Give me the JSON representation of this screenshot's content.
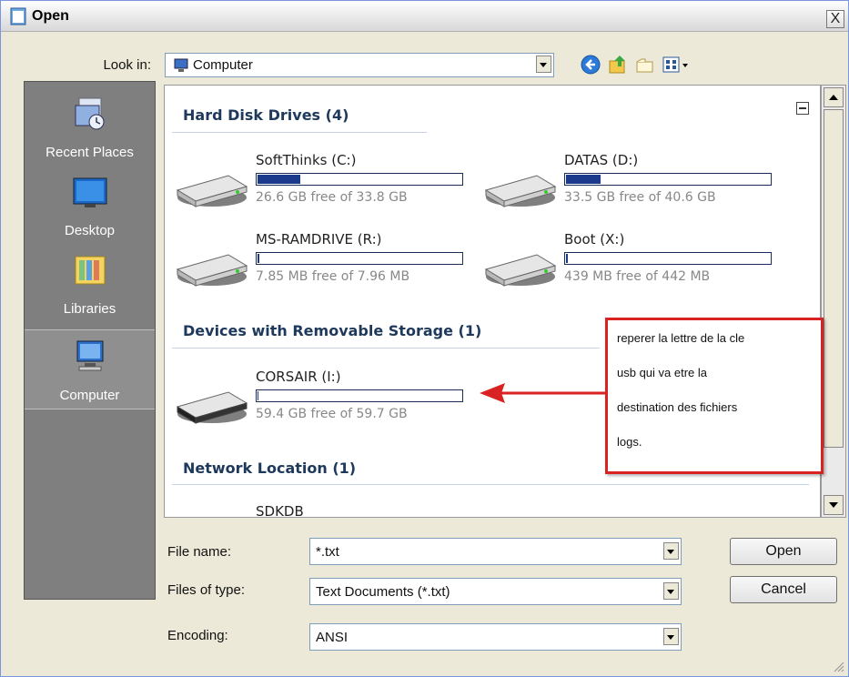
{
  "window": {
    "title": "Open",
    "close_symbol": "X"
  },
  "look_in": {
    "label": "Look in:",
    "value": "Computer"
  },
  "places": [
    {
      "label": "Recent Places",
      "icon": "recent-places-icon"
    },
    {
      "label": "Desktop",
      "icon": "desktop-icon"
    },
    {
      "label": "Libraries",
      "icon": "libraries-icon"
    },
    {
      "label": "Computer",
      "icon": "computer-icon",
      "selected": true
    }
  ],
  "groups": {
    "hard_disks": {
      "header": "Hard Disk Drives (4)",
      "drives": [
        {
          "name": "SoftThinks (C:)",
          "free": "26.6 GB free of 33.8 GB",
          "used_fraction": 0.21
        },
        {
          "name": "DATAS (D:)",
          "free": "33.5 GB free of 40.6 GB",
          "used_fraction": 0.17
        },
        {
          "name": "MS-RAMDRIVE (R:)",
          "free": "7.85 MB free of 7.96 MB",
          "used_fraction": 0.01
        },
        {
          "name": "Boot (X:)",
          "free": "439 MB free of 442 MB",
          "used_fraction": 0.01
        }
      ]
    },
    "removable": {
      "header": "Devices with Removable Storage (1)",
      "drives": [
        {
          "name": "CORSAIR (I:)",
          "free": "59.4 GB free of 59.7 GB",
          "used_fraction": 0.005
        }
      ]
    },
    "network": {
      "header": "Network Location (1)",
      "items": [
        {
          "name": "SDKDB"
        }
      ]
    }
  },
  "annotation": {
    "lines": [
      "reperer la lettre de la cle",
      "usb qui va etre la",
      "destination des fichiers",
      "logs."
    ],
    "color": "#d92222"
  },
  "form": {
    "file_name": {
      "label": "File name:",
      "value": "*.txt"
    },
    "file_type": {
      "label": "Files of type:",
      "value": "Text Documents (*.txt)"
    },
    "encoding": {
      "label": "Encoding:",
      "value": "ANSI"
    }
  },
  "buttons": {
    "open": "Open",
    "cancel": "Cancel"
  }
}
